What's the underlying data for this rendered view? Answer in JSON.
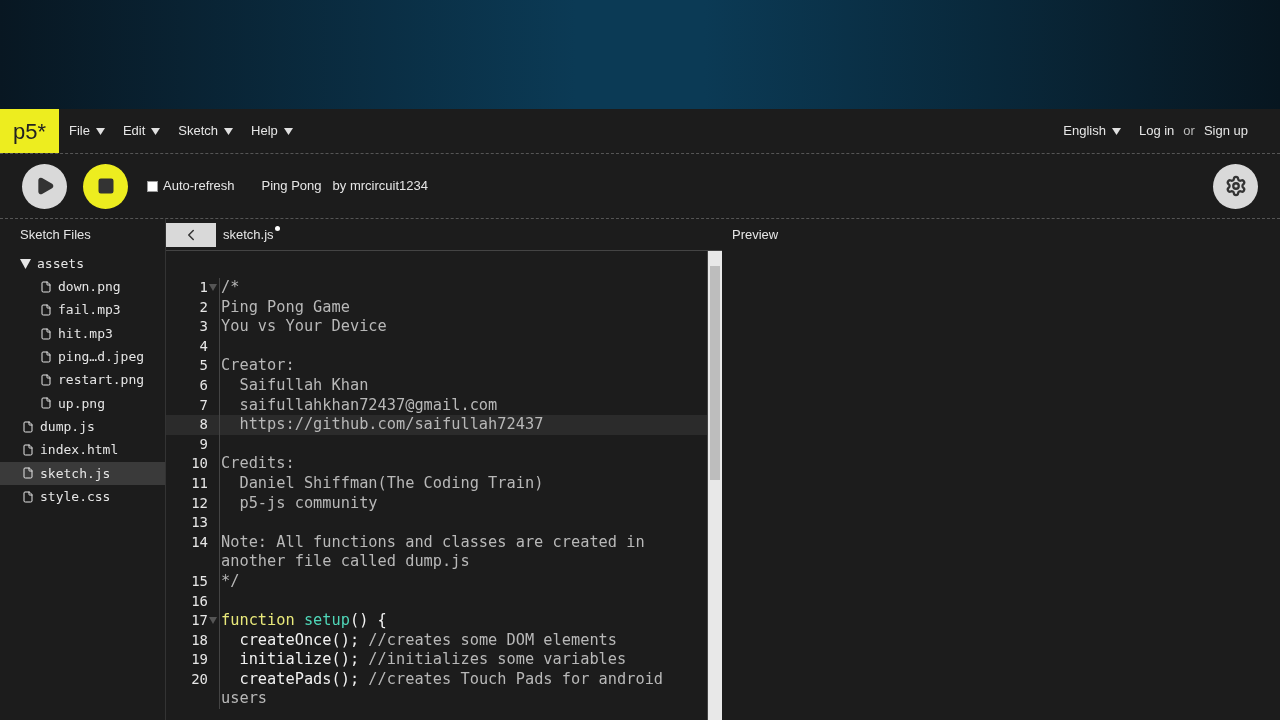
{
  "logo": "p5*",
  "menu": [
    {
      "label": "File"
    },
    {
      "label": "Edit"
    },
    {
      "label": "Sketch"
    },
    {
      "label": "Help"
    }
  ],
  "nav_right": {
    "language": "English",
    "login": "Log in",
    "or": "or",
    "signup": "Sign up"
  },
  "toolbar": {
    "auto_refresh": {
      "label": "Auto-refresh",
      "checked": false
    },
    "sketch_name": "Ping Pong",
    "author": "by mrcircuit1234"
  },
  "sidebar": {
    "title": "Sketch Files",
    "items": [
      {
        "kind": "folder",
        "label": "assets",
        "expanded": true,
        "selected": false,
        "children": [
          {
            "kind": "file",
            "label": "down.png",
            "selected": false
          },
          {
            "kind": "file",
            "label": "fail.mp3",
            "selected": false
          },
          {
            "kind": "file",
            "label": "hit.mp3",
            "selected": false
          },
          {
            "kind": "file",
            "label": "ping…d.jpeg",
            "selected": false
          },
          {
            "kind": "file",
            "label": "restart.png",
            "selected": false
          },
          {
            "kind": "file",
            "label": "up.png",
            "selected": false
          }
        ]
      },
      {
        "kind": "file",
        "label": "dump.js",
        "selected": false
      },
      {
        "kind": "file",
        "label": "index.html",
        "selected": false
      },
      {
        "kind": "file",
        "label": "sketch.js",
        "selected": true
      },
      {
        "kind": "file",
        "label": "style.css",
        "selected": false
      }
    ]
  },
  "editor": {
    "tab": "sketch.js",
    "unsaved": true,
    "lines": [
      {
        "number": "1",
        "fold": true,
        "active": false,
        "segments": [
          {
            "kind": "comment",
            "text": "/*"
          }
        ]
      },
      {
        "number": "2",
        "fold": false,
        "active": false,
        "segments": [
          {
            "kind": "comment",
            "text": "Ping Pong Game"
          }
        ]
      },
      {
        "number": "3",
        "fold": false,
        "active": false,
        "segments": [
          {
            "kind": "comment",
            "text": "You vs Your Device"
          }
        ]
      },
      {
        "number": "4",
        "fold": false,
        "active": false
      },
      {
        "number": "5",
        "fold": false,
        "active": false,
        "segments": [
          {
            "kind": "comment",
            "text": "Creator:"
          }
        ]
      },
      {
        "number": "6",
        "fold": false,
        "active": false,
        "segments": [
          {
            "kind": "comment",
            "text": "  Saifullah Khan"
          }
        ]
      },
      {
        "number": "7",
        "fold": false,
        "active": false,
        "segments": [
          {
            "kind": "comment",
            "text": "  saifullahkhan72437@gmail.com"
          }
        ]
      },
      {
        "number": "8",
        "fold": false,
        "active": true,
        "segments": [
          {
            "kind": "comment",
            "text": "  https://github.com/saifullah72437"
          }
        ]
      },
      {
        "number": "9",
        "fold": false,
        "active": false
      },
      {
        "number": "10",
        "fold": false,
        "active": false,
        "segments": [
          {
            "kind": "comment",
            "text": "Credits:"
          }
        ]
      },
      {
        "number": "11",
        "fold": false,
        "active": false,
        "segments": [
          {
            "kind": "comment",
            "text": "  Daniel Shiffman(The Coding Train)"
          }
        ]
      },
      {
        "number": "12",
        "fold": false,
        "active": false,
        "segments": [
          {
            "kind": "comment",
            "text": "  p5-js community"
          }
        ]
      },
      {
        "number": "13",
        "fold": false,
        "active": false
      },
      {
        "number": "14",
        "fold": false,
        "active": false,
        "segments": [
          {
            "kind": "comment",
            "text": "Note: All functions and classes are created in another file called dump.js"
          }
        ]
      },
      {
        "number": "15",
        "fold": false,
        "active": false,
        "segments": [
          {
            "kind": "comment",
            "text": "*/"
          }
        ]
      },
      {
        "number": "16",
        "fold": false,
        "active": false
      },
      {
        "number": "17",
        "fold": true,
        "active": false,
        "segments": [
          {
            "kind": "keyword",
            "text": "function "
          },
          {
            "kind": "def",
            "text": "setup"
          },
          {
            "kind": "plain",
            "text": "() {"
          }
        ]
      },
      {
        "number": "18",
        "fold": false,
        "active": false,
        "segments": [
          {
            "kind": "plain",
            "text": "  createOnce();"
          },
          {
            "kind": "comment",
            "text": " //creates some DOM elements"
          }
        ]
      },
      {
        "number": "19",
        "fold": false,
        "active": false,
        "segments": [
          {
            "kind": "plain",
            "text": "  initialize();"
          },
          {
            "kind": "comment",
            "text": " //initializes some variables"
          }
        ]
      },
      {
        "number": "20",
        "fold": false,
        "active": false,
        "segments": [
          {
            "kind": "plain",
            "text": "  createPads();"
          },
          {
            "kind": "comment",
            "text": " //creates Touch Pads for android users"
          }
        ]
      }
    ]
  },
  "preview": {
    "title": "Preview"
  }
}
